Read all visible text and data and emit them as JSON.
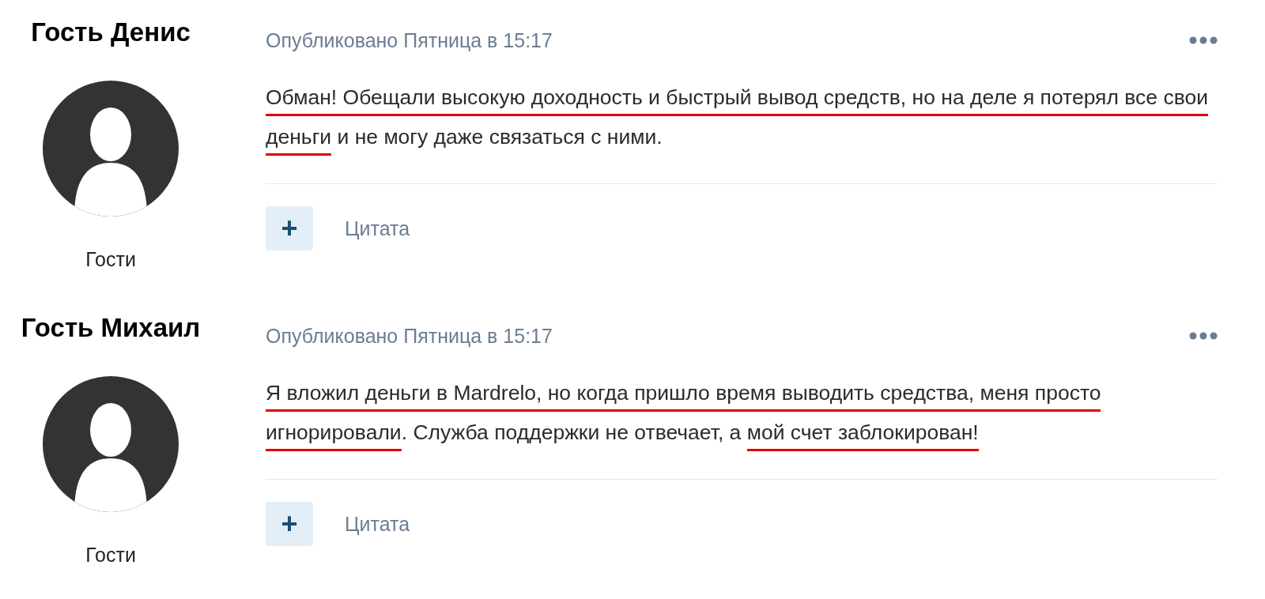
{
  "posts": [
    {
      "author": "Гость Денис",
      "group": "Гости",
      "meta": "Опубликовано Пятница в 15:17",
      "body": [
        {
          "text": "Обман! Обещали высокую доходность и быстрый вывод средств, но на деле я потерял все свои деньги",
          "underlined": true
        },
        {
          "text": " и не могу даже связаться с ними.",
          "underlined": false
        }
      ],
      "add_label": "+",
      "quote_label": "Цитата"
    },
    {
      "author": "Гость Михаил",
      "group": "Гости",
      "meta": "Опубликовано Пятница в 15:17",
      "body": [
        {
          "text": "Я вложил деньги в Mardrelo, но когда пришло время выводить средства, меня просто игнорировали",
          "underlined": true
        },
        {
          "text": ". Служба поддержки не отвечает, а ",
          "underlined": false
        },
        {
          "text": "мой счет заблокирован!",
          "underlined": true
        }
      ],
      "add_label": "+",
      "quote_label": "Цитата"
    }
  ]
}
